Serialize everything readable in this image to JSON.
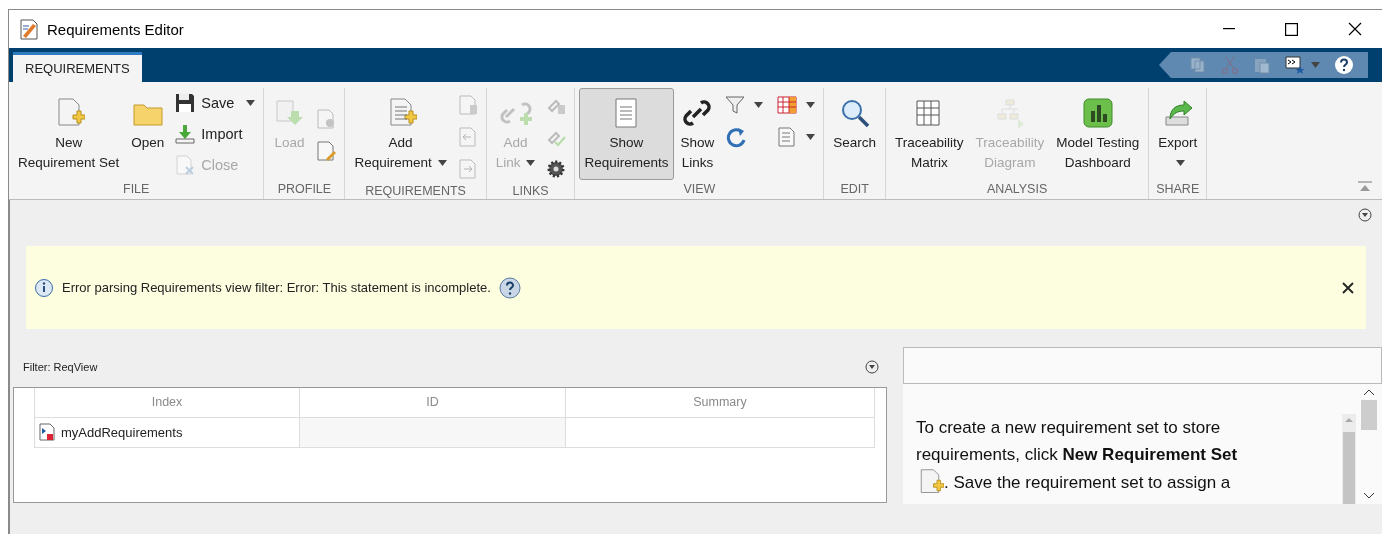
{
  "window": {
    "title": "Requirements Editor"
  },
  "tabs": [
    {
      "label": "REQUIREMENTS",
      "selected": true
    }
  ],
  "quick_access": [
    {
      "disabled": true
    },
    {
      "disabled": true
    },
    {
      "disabled": true
    },
    {
      "disabled": false
    },
    {
      "disabled": false
    }
  ],
  "ribbon": {
    "sections": [
      {
        "label": "FILE",
        "large": [
          {
            "lines": [
              "New",
              "Requirement Set"
            ],
            "disabled": false,
            "selected": false
          },
          {
            "lines": [
              "Open"
            ],
            "disabled": false,
            "selected": false
          }
        ],
        "small": [
          {
            "label": "Save",
            "disabled": false,
            "dropdown": true
          },
          {
            "label": "Import",
            "disabled": false
          },
          {
            "label": "Close",
            "disabled": true
          }
        ]
      },
      {
        "label": "PROFILE",
        "large": [
          {
            "lines": [
              "Load"
            ],
            "disabled": true,
            "selected": false
          }
        ],
        "icons": [
          {
            "disabled": true
          },
          {
            "disabled": false
          }
        ]
      },
      {
        "label": "REQUIREMENTS",
        "large": [
          {
            "lines": [
              "Add",
              "Requirement"
            ],
            "disabled": false,
            "dropdown": true,
            "selected": false
          }
        ],
        "icons": [
          {
            "disabled": true
          },
          {
            "disabled": true
          },
          {
            "disabled": true
          }
        ]
      },
      {
        "label": "LINKS",
        "large": [
          {
            "lines": [
              "Add",
              "Link"
            ],
            "disabled": true,
            "dropdown": true,
            "selected": false
          }
        ],
        "icons": [
          {
            "disabled": true
          },
          {
            "disabled": true
          },
          {
            "disabled": false
          }
        ]
      },
      {
        "label": "VIEW",
        "large": [
          {
            "lines": [
              "Show",
              "Requirements"
            ],
            "disabled": false,
            "selected": true
          },
          {
            "lines": [
              "Show",
              "Links"
            ],
            "disabled": false,
            "selected": false
          }
        ],
        "icons": [
          {
            "disabled": false,
            "dropdown": true
          },
          {
            "disabled": false,
            "dropdown": true
          },
          {
            "disabled": false
          },
          {
            "disabled": false,
            "dropdown": true
          }
        ]
      },
      {
        "label": "EDIT",
        "large": [
          {
            "lines": [
              "Search"
            ],
            "disabled": false,
            "selected": false
          }
        ]
      },
      {
        "label": "ANALYSIS",
        "large": [
          {
            "lines": [
              "Traceability",
              "Matrix"
            ],
            "disabled": false,
            "selected": false
          },
          {
            "lines": [
              "Traceability",
              "Diagram"
            ],
            "disabled": true,
            "selected": false
          },
          {
            "lines": [
              "Model Testing",
              "Dashboard"
            ],
            "disabled": false,
            "selected": false
          }
        ]
      },
      {
        "label": "SHARE",
        "large": [
          {
            "lines": [
              "Export"
            ],
            "disabled": false,
            "dropdown": true,
            "selected": false
          }
        ]
      }
    ]
  },
  "message": {
    "text": "Error parsing Requirements view filter: Error: This statement is incomplete."
  },
  "filter": {
    "label": "Filter: ReqView"
  },
  "table": {
    "columns": [
      "Index",
      "ID",
      "Summary"
    ],
    "rows": [
      {
        "index": "myAddRequirements"
      }
    ]
  },
  "details": {
    "intro": "To create a new requirement set to store requirements, click **New Requirement Set**",
    "after_icon": ". Save the requirement set to assign a"
  }
}
